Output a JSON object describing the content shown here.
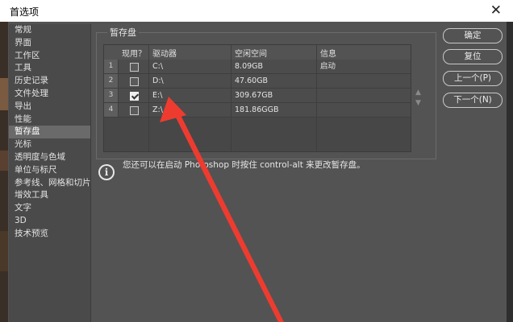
{
  "window": {
    "title": "首选项",
    "close_glyph": "✕"
  },
  "sidebar": {
    "items": [
      {
        "label": "常规"
      },
      {
        "label": "界面"
      },
      {
        "label": "工作区"
      },
      {
        "label": "工具"
      },
      {
        "label": "历史记录"
      },
      {
        "label": "文件处理"
      },
      {
        "label": "导出"
      },
      {
        "label": "性能"
      },
      {
        "label": "暂存盘"
      },
      {
        "label": "光标"
      },
      {
        "label": "透明度与色域"
      },
      {
        "label": "单位与标尺"
      },
      {
        "label": "参考线、网格和切片"
      },
      {
        "label": "增效工具"
      },
      {
        "label": "文字"
      },
      {
        "label": "3D"
      },
      {
        "label": "技术预览"
      }
    ],
    "selected_index": 8
  },
  "scratch": {
    "group_title": "暂存盘",
    "columns": [
      "现用？",
      "驱动器",
      "空闲空间",
      "信息"
    ],
    "rows": [
      {
        "num": "1",
        "active": false,
        "drive": "C:\\",
        "free": "8.09GB",
        "info": "启动"
      },
      {
        "num": "2",
        "active": false,
        "drive": "D:\\",
        "free": "47.60GB",
        "info": ""
      },
      {
        "num": "3",
        "active": true,
        "drive": "E:\\",
        "free": "309.67GB",
        "info": ""
      },
      {
        "num": "4",
        "active": false,
        "drive": "Z:\\",
        "free": "181.86GGB",
        "info": ""
      }
    ],
    "move_up_glyph": "▲",
    "move_down_glyph": "▼"
  },
  "buttons": {
    "ok": "确定",
    "reset": "复位",
    "prev": "上一个(P)",
    "next": "下一个(N)"
  },
  "info": {
    "icon": "i",
    "text": "您还可以在启动 Photoshop 时按住 control-alt 来更改暂存盘。"
  },
  "colors": {
    "accent_arrow": "#ee3b30"
  }
}
